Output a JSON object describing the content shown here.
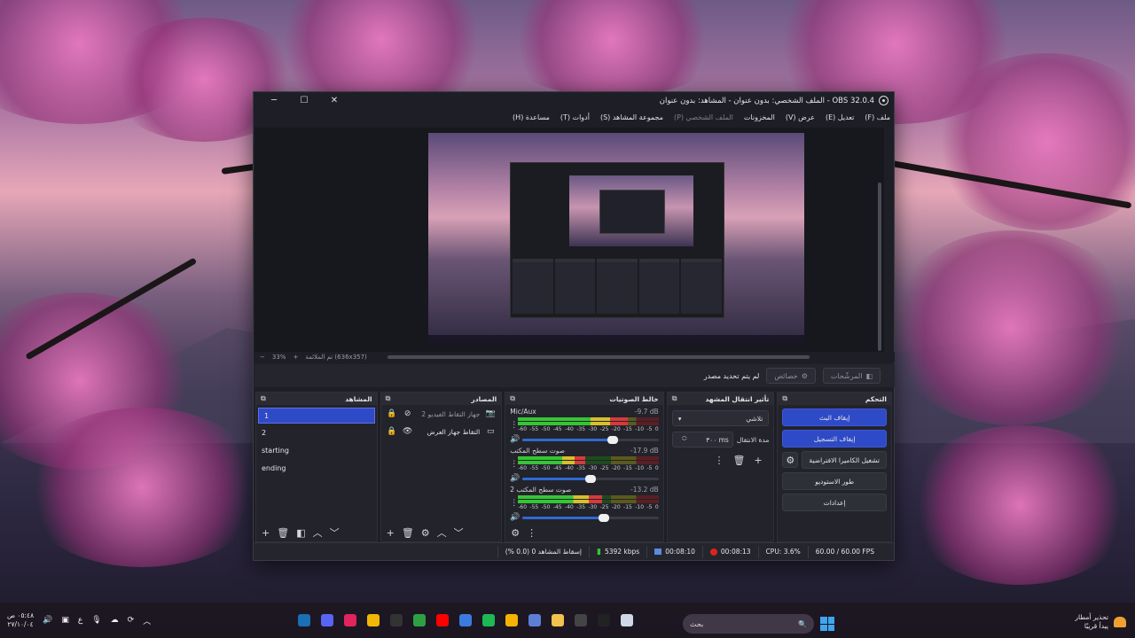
{
  "window": {
    "title": "OBS 32.0.4 - الملف الشخصي: بدون عنوان - المشاهد: بدون عنوان",
    "minimize": "─",
    "maximize": "☐",
    "close": "✕"
  },
  "menu": [
    {
      "label": "ملف (F)",
      "enabled": true
    },
    {
      "label": "تعديل (E)",
      "enabled": true
    },
    {
      "label": "عرض (V)",
      "enabled": true
    },
    {
      "label": "المخزونات",
      "enabled": true
    },
    {
      "label": "الملف الشخصي (P)",
      "enabled": false
    },
    {
      "label": "مجموعة المشاهد (S)",
      "enabled": true
    },
    {
      "label": "أدوات (T)",
      "enabled": true
    },
    {
      "label": "مساعدة (H)",
      "enabled": true
    }
  ],
  "preview": {
    "zoom": "33%",
    "zoom_minus": "−",
    "zoom_plus": "+",
    "fit_label": "تم الملائمة (636x357)"
  },
  "source_bar": {
    "no_source": "لم يتم تحديد مصدر",
    "properties": "خصائص",
    "filters": "المرشّحات"
  },
  "docks": {
    "scenes": {
      "title": "المشاهد",
      "items": [
        "1",
        "2",
        "starting",
        "ending"
      ],
      "selected": 0
    },
    "sources": {
      "title": "المصادر",
      "items": [
        {
          "name": "جهاز التقاط الفيديو 2",
          "icon": "camera-icon",
          "visible": false
        },
        {
          "name": "التقاط جهاز العرض",
          "icon": "monitor-icon",
          "visible": true
        }
      ]
    },
    "mixer": {
      "title": "خالط الصوتيات",
      "ticks": [
        "-60",
        "-55",
        "-50",
        "-45",
        "-40",
        "-35",
        "-30",
        "-25",
        "-20",
        "-15",
        "-10",
        "-5",
        "0"
      ],
      "channels": [
        {
          "name": "Mic/Aux",
          "db": "-9.7 dB",
          "level": 0.78,
          "volume": 0.66
        },
        {
          "name": "صوت سطح المكتب",
          "db": "-17.9 dB",
          "level": 0.48,
          "volume": 0.5
        },
        {
          "name": "صوت سطح المكتب 2",
          "db": "-13.2 dB",
          "level": 0.6,
          "volume": 0.6
        }
      ]
    },
    "transitions": {
      "title": "تأثير انتقال المشهد",
      "type": "تلاشي",
      "duration_label": "مدة الانتقال",
      "duration_value": "٣٠٠ ms"
    },
    "controls": {
      "title": "التحكم",
      "stop_stream": "إيقاف البث",
      "stop_recording": "إيقاف التسجيل",
      "virtual_camera": "تشغيل الكاميرا الافتراضية",
      "studio_mode": "طور الاستوديو",
      "settings": "إعدادات"
    }
  },
  "status": {
    "dropped": "إسقاط المشاهد 0 (0.0 %)",
    "bitrate": "5392 kbps",
    "stream_time": "00:08:10",
    "rec_time": "00:08:13",
    "cpu": "CPU: 3.6%",
    "fps": "60.00 / 60.00 FPS"
  },
  "taskbar": {
    "search_placeholder": "بحث",
    "time": "٠٥:٤٨ ص",
    "date": "٢٧/١٠/٠٤",
    "lang": "ع",
    "weather_line1": "تحذير أمطار",
    "weather_line2": "يبدأ قريبًا",
    "apps": [
      {
        "name": "steam-icon",
        "color": "#1b6fb4"
      },
      {
        "name": "discord-icon",
        "color": "#5865f2"
      },
      {
        "name": "adobe-icon",
        "color": "#e0245e"
      },
      {
        "name": "rockstar-icon",
        "color": "#f2b705"
      },
      {
        "name": "epic-icon",
        "color": "#333333"
      },
      {
        "name": "xbox-icon",
        "color": "#2ea043"
      },
      {
        "name": "youtube-icon",
        "color": "#ff0000"
      },
      {
        "name": "app-blue-icon",
        "color": "#3b7be0"
      },
      {
        "name": "spotify-icon",
        "color": "#1db954"
      },
      {
        "name": "chrome-icon",
        "color": "#f4b400"
      },
      {
        "name": "store-icon",
        "color": "#5c7fd6"
      },
      {
        "name": "explorer-icon",
        "color": "#f2c14e"
      },
      {
        "name": "obs-icon",
        "color": "#444444"
      },
      {
        "name": "capcut-icon",
        "color": "#222222"
      },
      {
        "name": "notepad-icon",
        "color": "#cfd8e6"
      }
    ]
  }
}
